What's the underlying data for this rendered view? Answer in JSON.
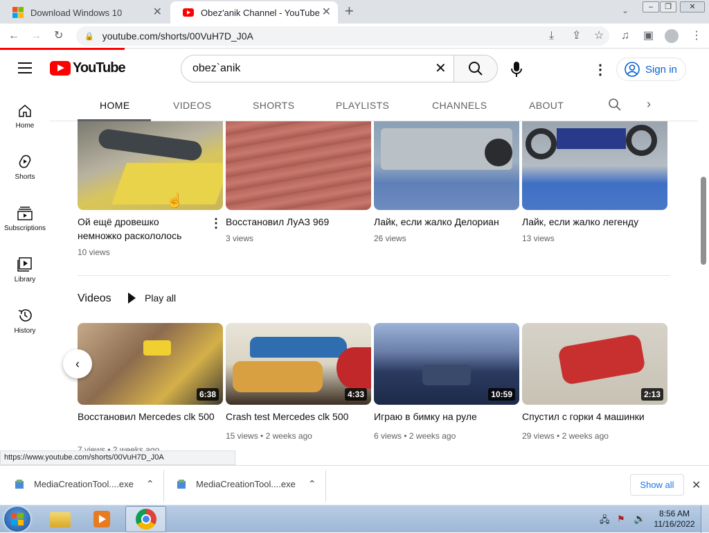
{
  "browser": {
    "tabs": [
      {
        "title": "Download Windows 10"
      },
      {
        "title": "Obez'anik Channel - YouTube"
      }
    ],
    "url": "youtube.com/shorts/00VuH7D_J0A",
    "status_url": "https://www.youtube.com/shorts/00VuH7D_J0A"
  },
  "youtube": {
    "logo_text": "YouTube",
    "search_value": "obez`anik",
    "signin_label": "Sign in",
    "sidebar": [
      {
        "label": "Home",
        "icon": "home-icon"
      },
      {
        "label": "Shorts",
        "icon": "shorts-icon"
      },
      {
        "label": "Subscriptions",
        "icon": "subscriptions-icon"
      },
      {
        "label": "Library",
        "icon": "library-icon"
      },
      {
        "label": "History",
        "icon": "history-icon"
      }
    ],
    "channel_tabs": [
      "HOME",
      "VIDEOS",
      "SHORTS",
      "PLAYLISTS",
      "CHANNELS",
      "ABOUT"
    ],
    "active_tab": "HOME",
    "shorts": [
      {
        "title": "Ой ещё дровешко немножко раскололось",
        "views": "10 views"
      },
      {
        "title": "Восстановил ЛуАЗ 969",
        "views": "3 views"
      },
      {
        "title": "Лайк, если жалко Делориан",
        "views": "26 views"
      },
      {
        "title": "Лайк, если жалко легенду",
        "views": "13 views"
      }
    ],
    "videos_section": {
      "heading": "Videos",
      "play_all": "Play all",
      "items": [
        {
          "title": "Восстановил Mercedes clk 500",
          "duration": "6:38",
          "views": "7 views",
          "age": "2 weeks ago"
        },
        {
          "title": "Crash test Mercedes clk 500",
          "duration": "4:33",
          "views": "15 views",
          "age": "2 weeks ago"
        },
        {
          "title": "Играю в бимку на руле",
          "duration": "10:59",
          "views": "6 views",
          "age": "2 weeks ago"
        },
        {
          "title": "Спустил с горки 4 машинки",
          "duration": "2:13",
          "views": "29 views",
          "age": "2 weeks ago"
        }
      ]
    }
  },
  "downloads": {
    "items": [
      {
        "name": "MediaCreationTool....exe"
      },
      {
        "name": "MediaCreationTool....exe"
      }
    ],
    "show_all": "Show all"
  },
  "taskbar": {
    "time": "8:56 AM",
    "date": "11/16/2022"
  },
  "colors": {
    "youtube_red": "#ff0000",
    "link_blue": "#065fd4",
    "chrome_tabbar": "#dee1e6"
  }
}
